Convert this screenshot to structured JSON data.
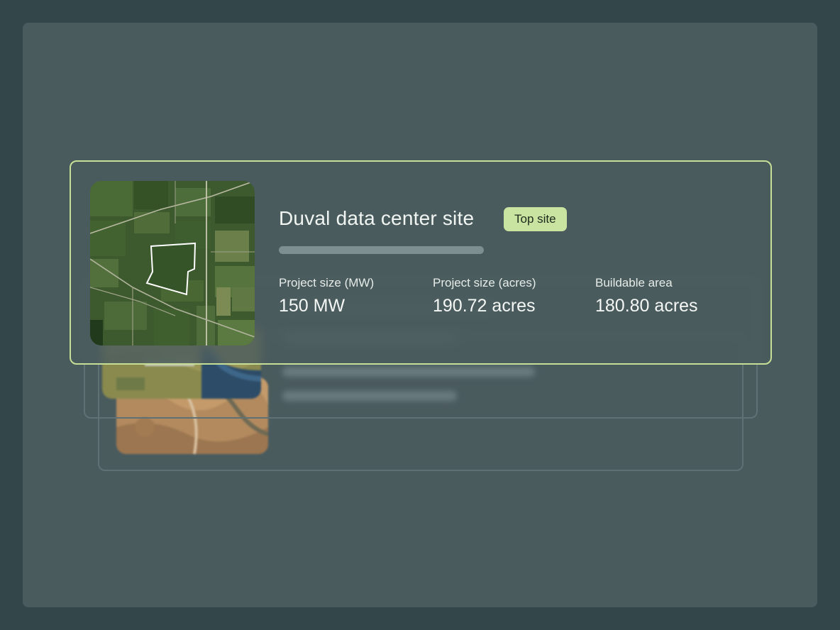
{
  "card": {
    "title": "Duval data center site",
    "badge": "Top site",
    "progress": 1.0,
    "stats": [
      {
        "label": "Project size (MW)",
        "value": "150 MW"
      },
      {
        "label": "Project size (acres)",
        "value": "190.72 acres"
      },
      {
        "label": "Buildable area",
        "value": "180.80 acres"
      }
    ],
    "map_icon": "satellite-map-parcel-outline"
  },
  "colors": {
    "outer_background": "#33474a",
    "panel_background": "#4a5b5e",
    "card_border": "#c6de95",
    "badge_background": "#c9e3a0",
    "badge_text": "#1c2a1d",
    "text_primary": "#f1f5f2",
    "map_green": "#3f5f2f",
    "parcel_outline": "#ffffff"
  }
}
